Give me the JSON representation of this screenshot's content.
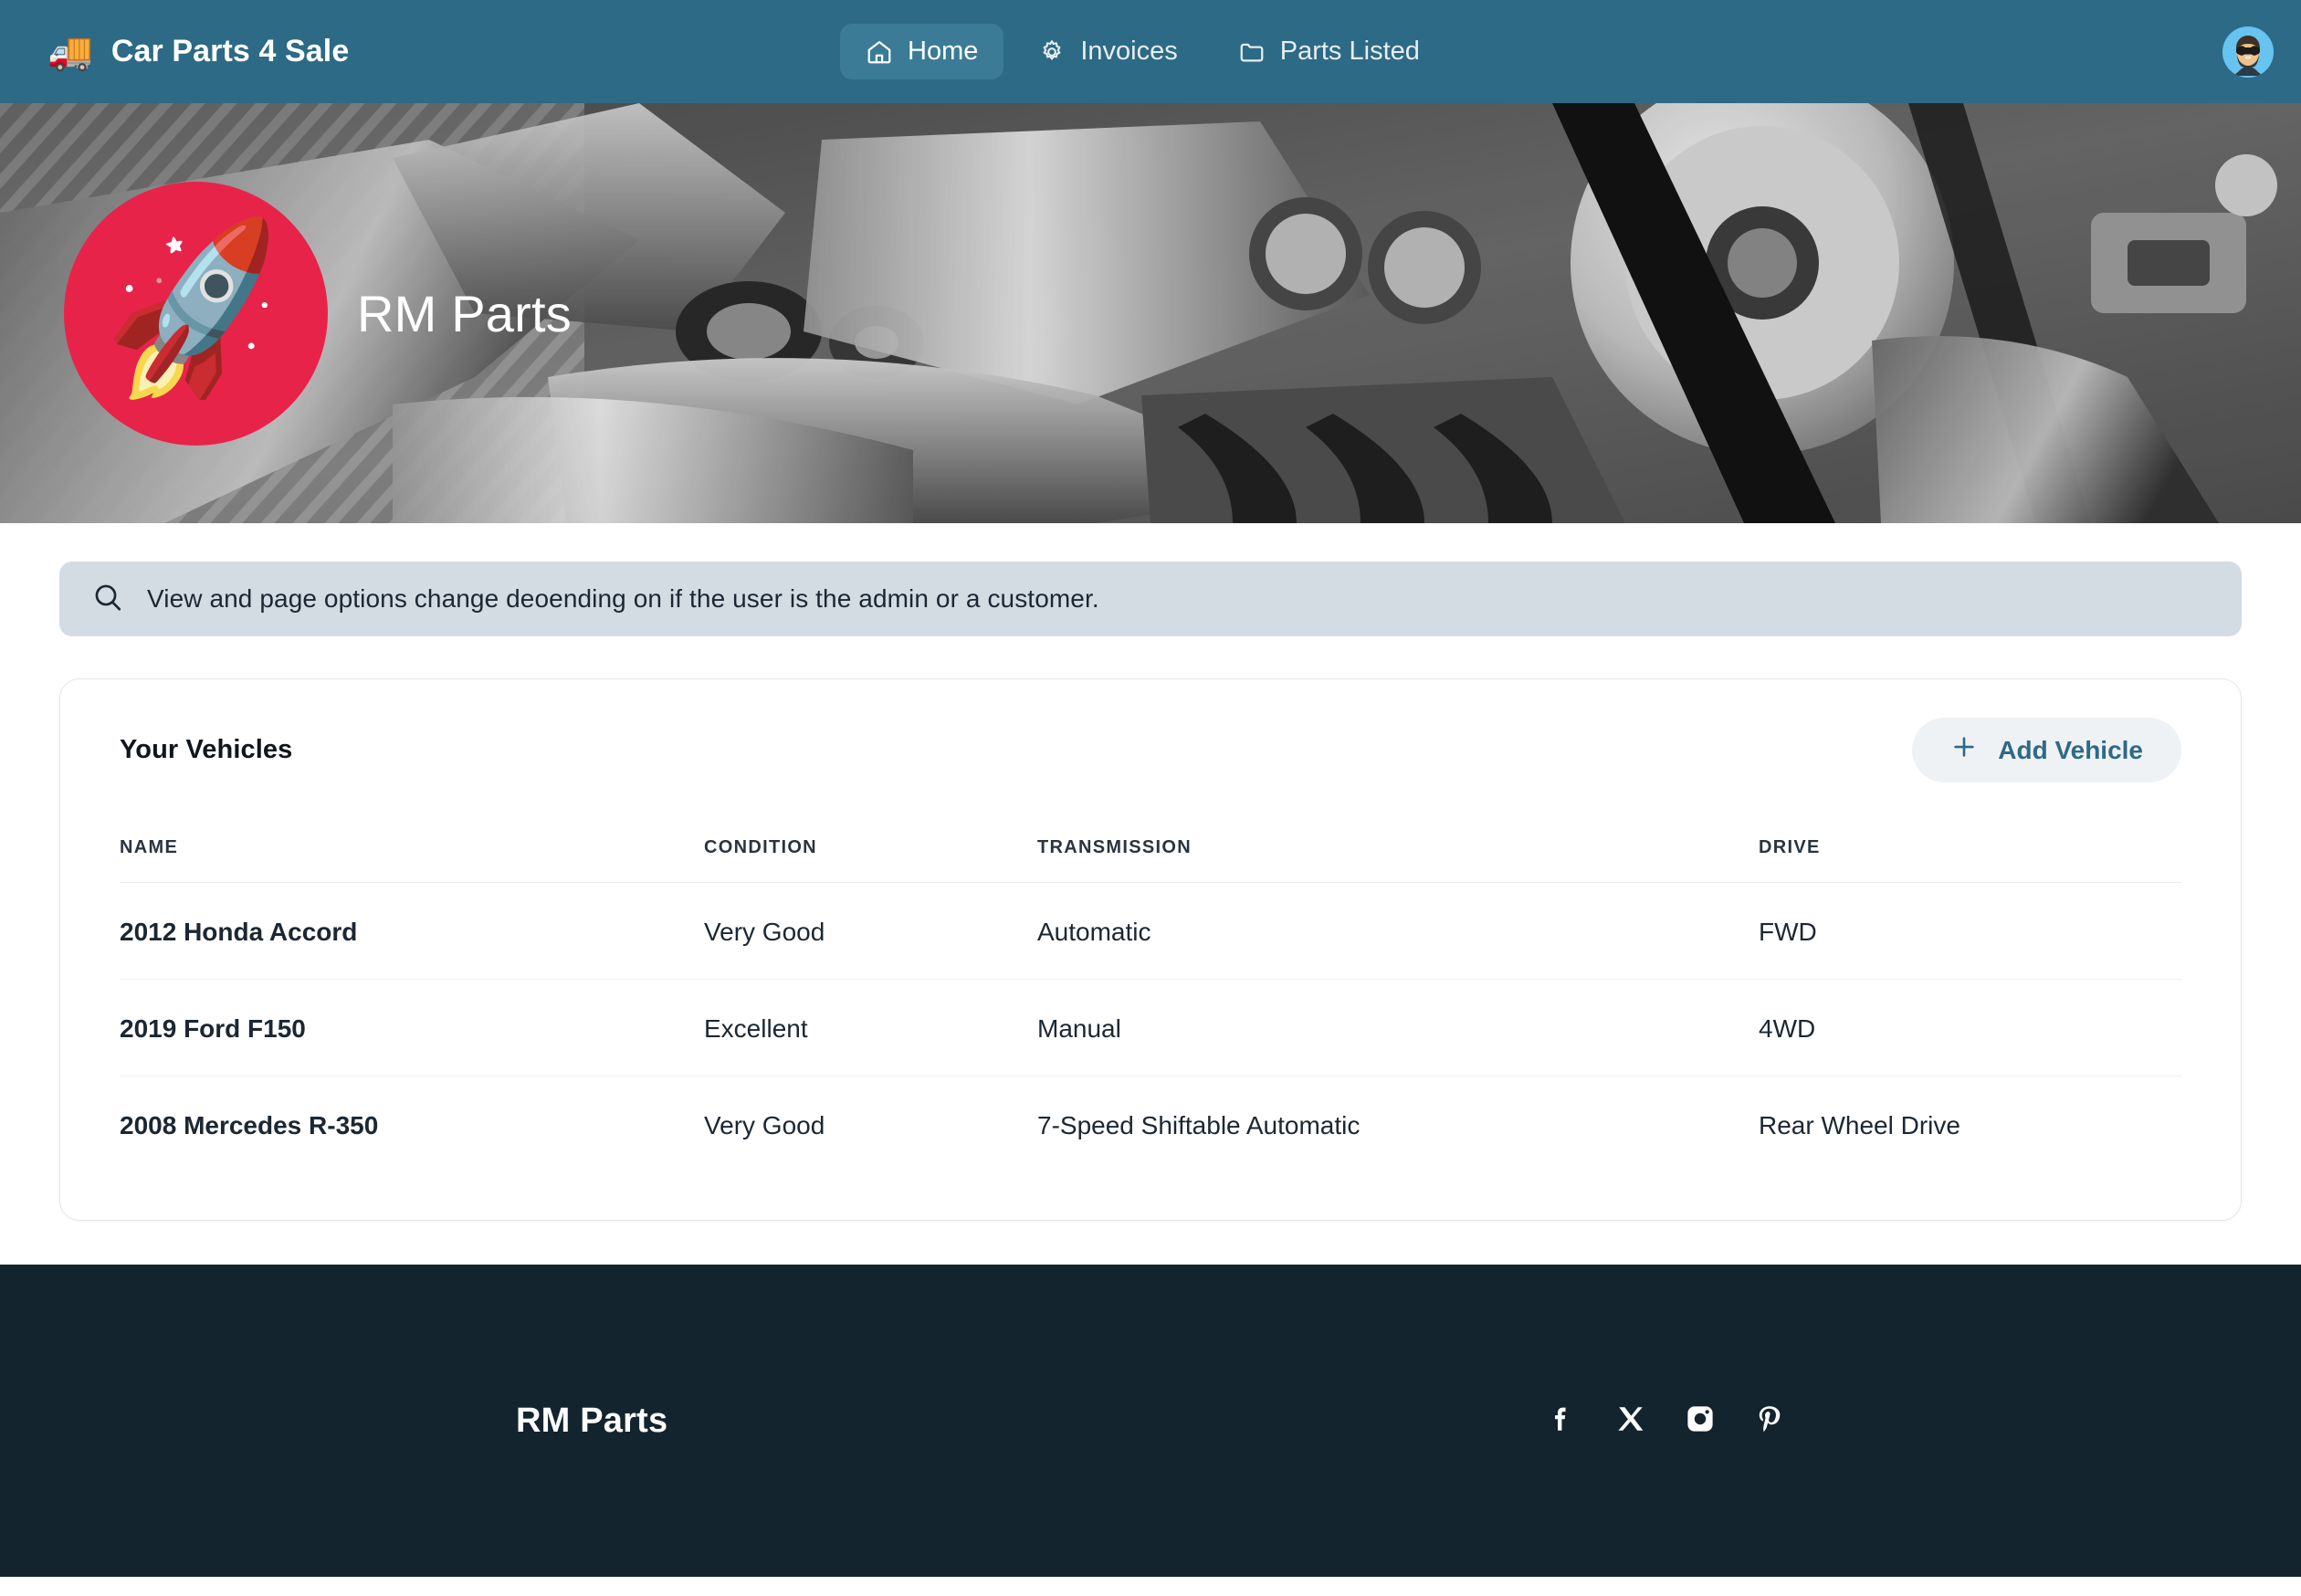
{
  "colors": {
    "nav_bg": "#2D6A85",
    "nav_active": "#3B7B96",
    "searchbar_bg": "#D3DCE3",
    "footer_bg": "#13242F",
    "accent": "#2D6A85",
    "logo_circle": "#E8234A",
    "add_btn_bg": "#EFF2F4"
  },
  "topnav": {
    "brand_icon": "truck-icon",
    "brand_emoji": "🚚",
    "brand_title": "Car Parts 4 Sale",
    "items": [
      {
        "label": "Home",
        "icon": "home-icon",
        "active": true
      },
      {
        "label": "Invoices",
        "icon": "gear-icon",
        "active": false
      },
      {
        "label": "Parts Listed",
        "icon": "folder-icon",
        "active": false
      }
    ],
    "avatar": "user-avatar"
  },
  "hero": {
    "logo_icon": "rocket-icon",
    "logo_emoji": "🚀",
    "title": "RM Parts",
    "background": "engine-parts-photo-grayscale"
  },
  "searchbar": {
    "icon": "search-icon",
    "text": "View and page options change deoending on if the user is the admin or a customer."
  },
  "card": {
    "title": "Your Vehicles",
    "add_button": {
      "label": "Add Vehicle",
      "icon": "plus-icon"
    },
    "table": {
      "columns": [
        "NAME",
        "CONDITION",
        "TRANSMISSION",
        "DRIVE"
      ],
      "rows": [
        {
          "name": "2012 Honda Accord",
          "condition": "Very Good",
          "transmission": "Automatic",
          "drive": "FWD"
        },
        {
          "name": "2019 Ford F150",
          "condition": "Excellent",
          "transmission": "Manual",
          "drive": "4WD"
        },
        {
          "name": "2008 Mercedes R-350",
          "condition": "Very Good",
          "transmission": "7-Speed Shiftable Automatic",
          "drive": "Rear Wheel Drive"
        }
      ]
    }
  },
  "footer": {
    "brand": "RM Parts",
    "socials": [
      {
        "name": "facebook-icon"
      },
      {
        "name": "x-twitter-icon"
      },
      {
        "name": "instagram-icon"
      },
      {
        "name": "pinterest-icon"
      }
    ]
  }
}
